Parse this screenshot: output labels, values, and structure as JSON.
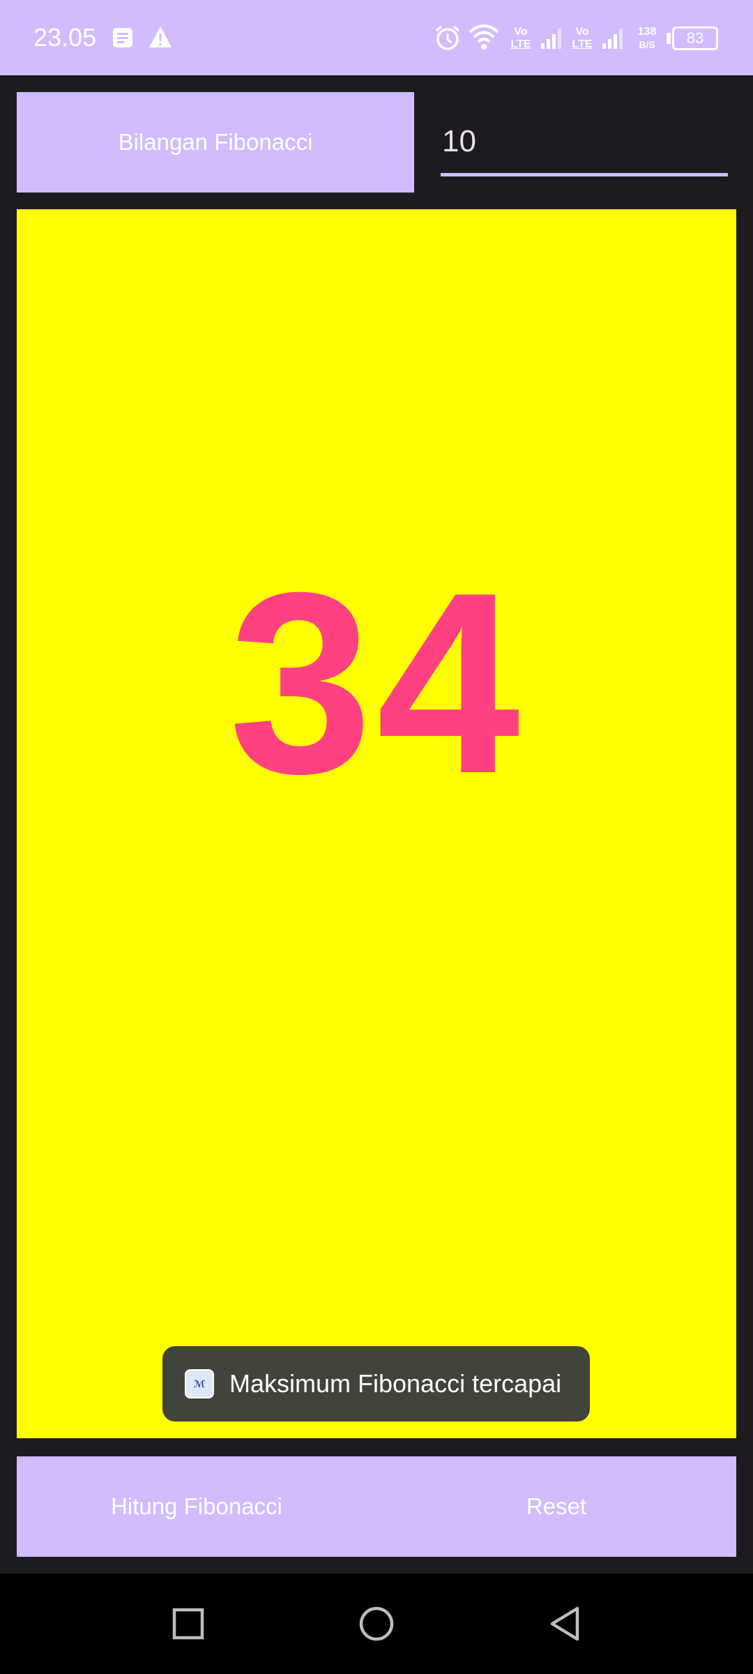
{
  "status_bar": {
    "time": "23.05",
    "notification_icons": [
      "notes-icon",
      "warning-icon"
    ],
    "right_icons": [
      "alarm-icon",
      "wifi-icon",
      "volte-icon",
      "signal-icon",
      "volte-icon",
      "signal-icon"
    ],
    "volte_label_top": "Vo",
    "volte_label_bottom": "LTE",
    "net_speed_value": "138",
    "net_speed_unit": "B/S",
    "battery": "83"
  },
  "header": {
    "fibonacci_button_label": "Bilangan Fibonacci",
    "input_value": "10"
  },
  "result": {
    "value": "34",
    "panel_color": "#ffff00",
    "number_color": "#ff4081"
  },
  "toast": {
    "app_icon": "app-icon",
    "message": "Maksimum Fibonacci tercapai"
  },
  "actions": {
    "calculate_label": "Hitung Fibonacci",
    "reset_label": "Reset"
  },
  "navigation": {
    "items": [
      "recents-icon",
      "home-icon",
      "back-icon"
    ]
  },
  "colors": {
    "accent": "#d0bcff",
    "background": "#1d1b20",
    "toast_bg": "#41443a"
  }
}
